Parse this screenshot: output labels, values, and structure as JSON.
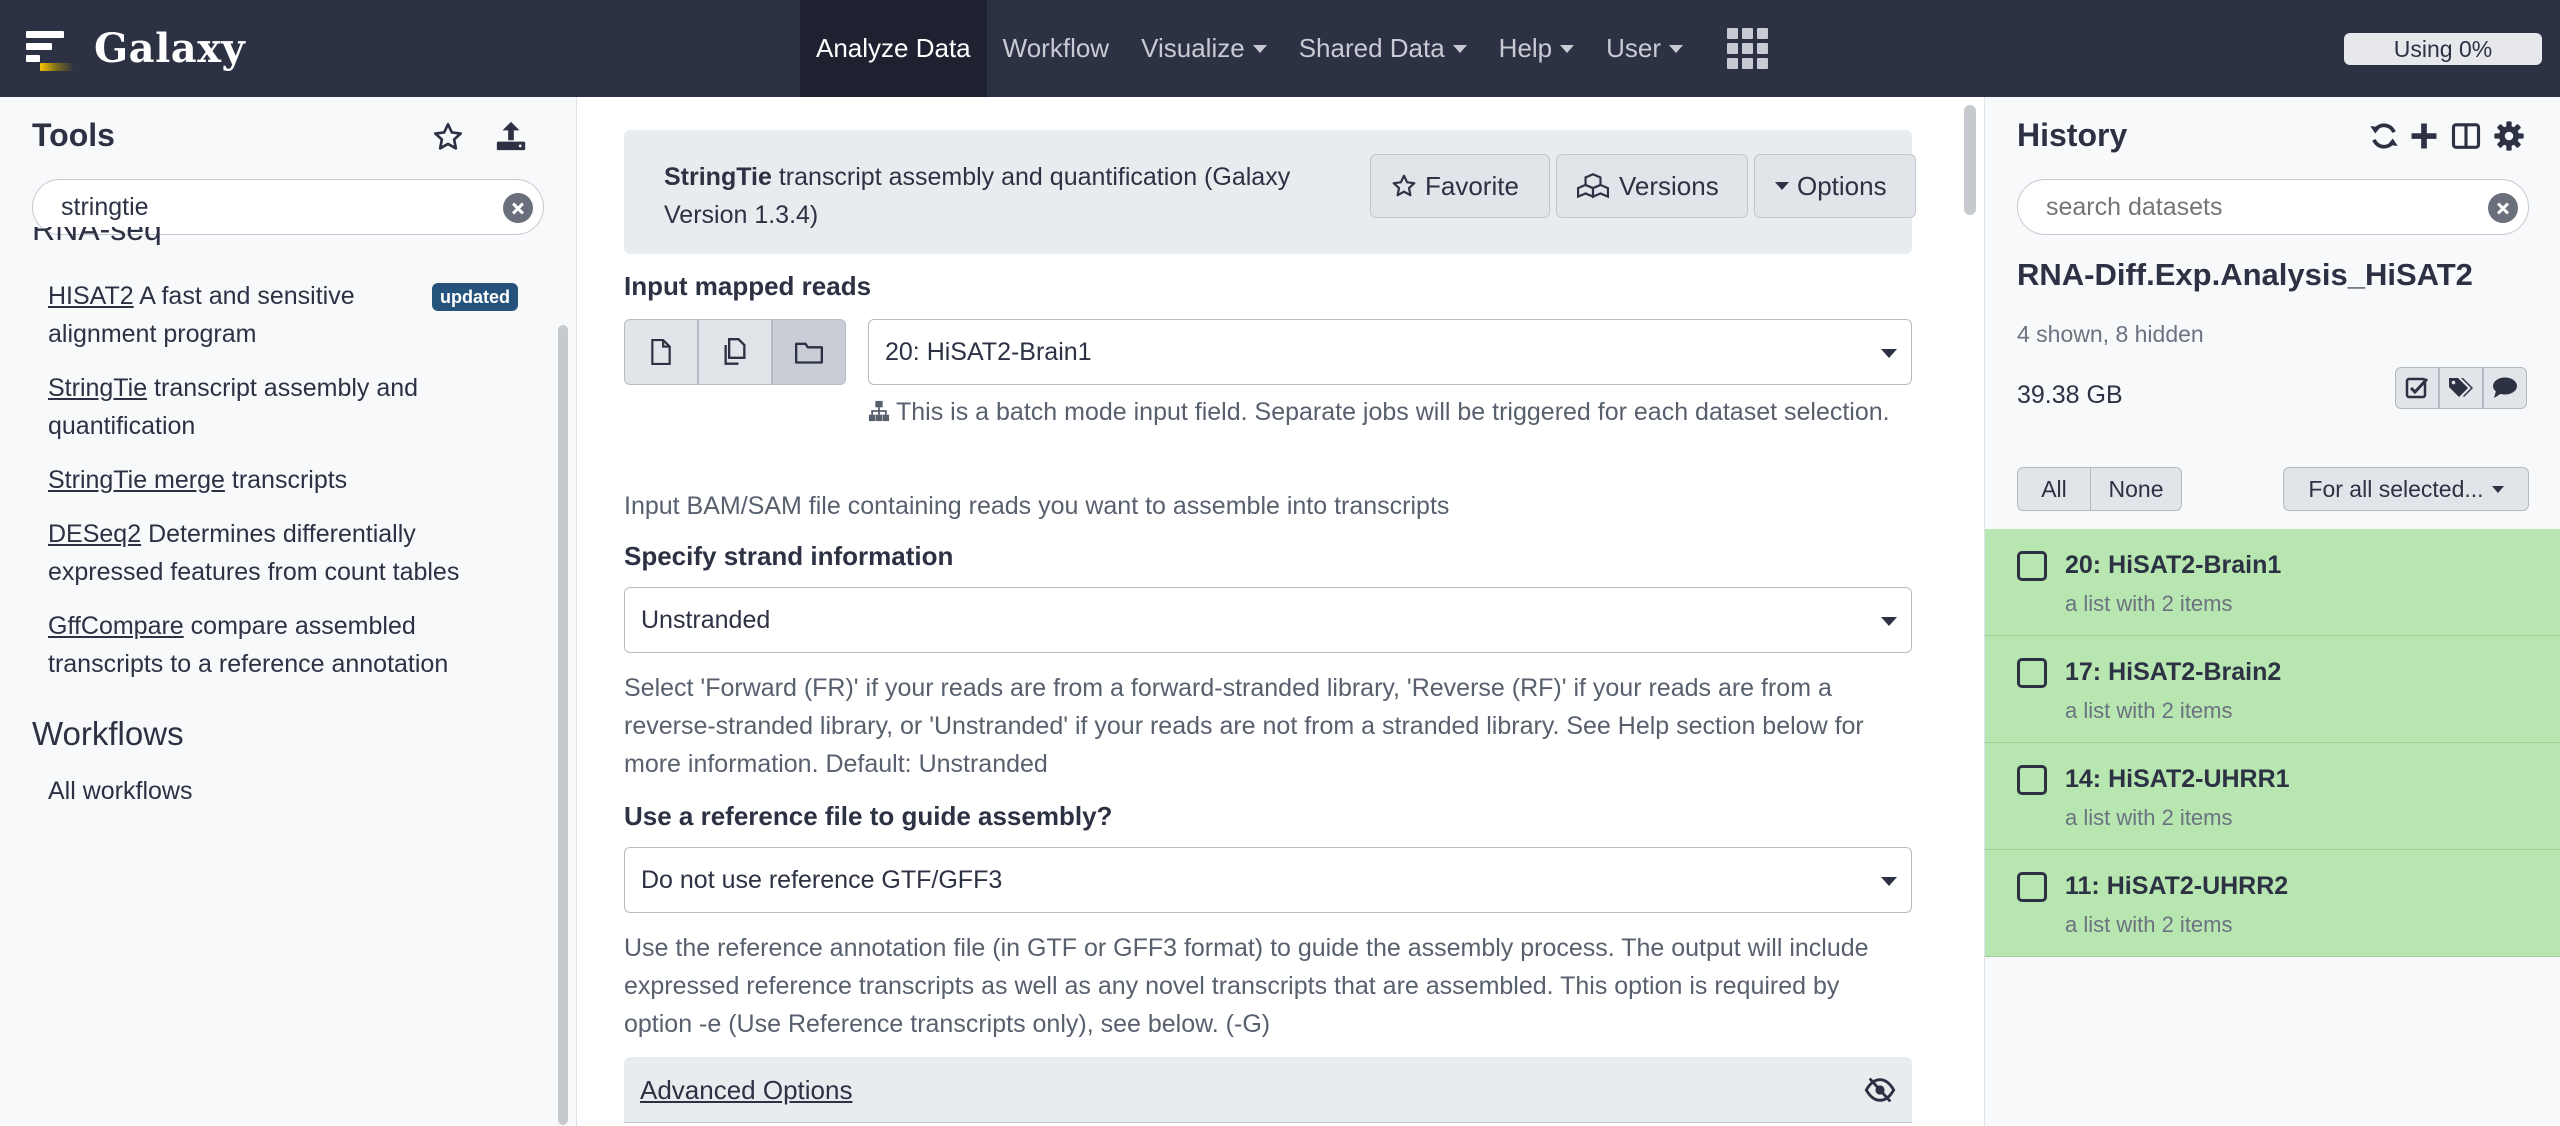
{
  "masthead": {
    "brand": "Galaxy",
    "nav": [
      {
        "label": "Analyze Data",
        "caret": false,
        "active": true
      },
      {
        "label": "Workflow",
        "caret": false,
        "active": false
      },
      {
        "label": "Visualize",
        "caret": true,
        "active": false
      },
      {
        "label": "Shared Data",
        "caret": true,
        "active": false
      },
      {
        "label": "Help",
        "caret": true,
        "active": false
      },
      {
        "label": "User",
        "caret": true,
        "active": false
      }
    ],
    "quota": "Using 0%"
  },
  "tools": {
    "title": "Tools",
    "search_value": "stringtie",
    "section_partial": "RNA-seq",
    "items": [
      {
        "name": "HISAT2",
        "desc": " A fast and sensitive alignment program",
        "badge": "updated"
      },
      {
        "name": "StringTie",
        "desc": " transcript assembly and quantification"
      },
      {
        "name": "StringTie merge",
        "desc": " transcripts"
      },
      {
        "name": "DESeq2",
        "desc": " Determines differentially expressed features from count tables"
      },
      {
        "name": "GffCompare",
        "desc": " compare assembled transcripts to a reference annotation"
      }
    ],
    "workflows_title": "Workflows",
    "all_workflows": "All workflows"
  },
  "form": {
    "tool_name": "StringTie",
    "tool_desc": " transcript assembly and quantification (Galaxy Version 1.3.4)",
    "favorite": "Favorite",
    "versions": "Versions",
    "options": "Options",
    "input_label": "Input mapped reads",
    "input_value": "20: HiSAT2-Brain1",
    "batch_note": "This is a batch mode input field. Separate jobs will be triggered for each dataset selection.",
    "input_help": "Input BAM/SAM file containing reads you want to assemble into transcripts",
    "strand_label": "Specify strand information",
    "strand_value": "Unstranded",
    "strand_help": "Select 'Forward (FR)' if your reads are from a forward-stranded library, 'Reverse (RF)' if your reads are from a reverse-stranded library, or 'Unstranded' if your reads are not from a stranded library. See Help section below for more information. Default: Unstranded",
    "ref_label": "Use a reference file to guide assembly?",
    "ref_value": "Do not use reference GTF/GFF3",
    "ref_help": "Use the reference annotation file (in GTF or GFF3 format) to guide the assembly process. The output will include expressed reference transcripts as well as any novel transcripts that are assembled. This option is required by option -e (Use Reference transcripts only), see below. (-G)",
    "advanced": "Advanced Options"
  },
  "history": {
    "title": "History",
    "search_placeholder": "search datasets",
    "name": "RNA-Diff.Exp.Analysis_HiSAT2",
    "meta": "4 shown, 8 hidden",
    "size": "39.38 GB",
    "all": "All",
    "none": "None",
    "for_all": "For all selected...",
    "datasets": [
      {
        "name": "20: HiSAT2-Brain1",
        "desc": "a list with 2 items"
      },
      {
        "name": "17: HiSAT2-Brain2",
        "desc": "a list with 2 items"
      },
      {
        "name": "14: HiSAT2-UHRR1",
        "desc": "a list with 2 items"
      },
      {
        "name": "11: HiSAT2-UHRR2",
        "desc": "a list with 2 items"
      }
    ],
    "ok_color": "#b8e6b0"
  },
  "colors": {
    "masthead": "#2c3143",
    "badge": "#25537b"
  }
}
